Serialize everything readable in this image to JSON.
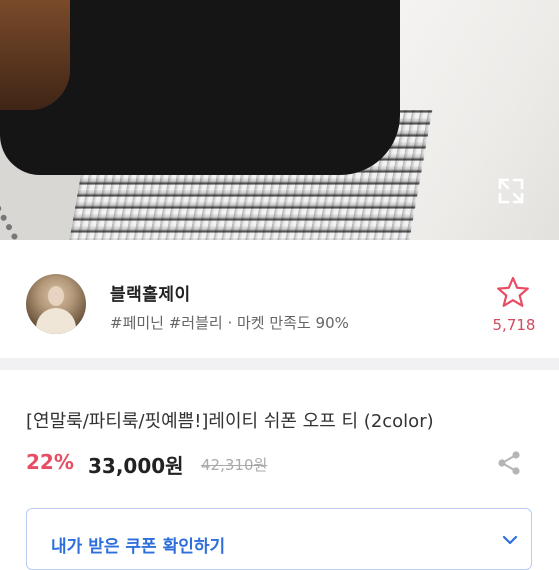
{
  "hero": {
    "image_desc": "product-photo",
    "expand_icon": "expand-icon"
  },
  "seller": {
    "name": "블랙홀제이",
    "tags": "#페미닌 #러블리 · 마켓 만족도 90%",
    "favorite_icon": "star-icon",
    "favorite_count": "5,718"
  },
  "product": {
    "title": "[연말룩/파티룩/핏예쁨!]레이티 쉬폰 오프 티 (2color)",
    "discount": "22%",
    "price": "33,000원",
    "original_price": "42,310원",
    "share_icon": "share-icon"
  },
  "coupon": {
    "label": "내가 받은 쿠폰 확인하기",
    "chevron_icon": "chevron-down-icon"
  },
  "colors": {
    "accent_pink": "#e84d63",
    "accent_blue": "#2f6fdc"
  }
}
